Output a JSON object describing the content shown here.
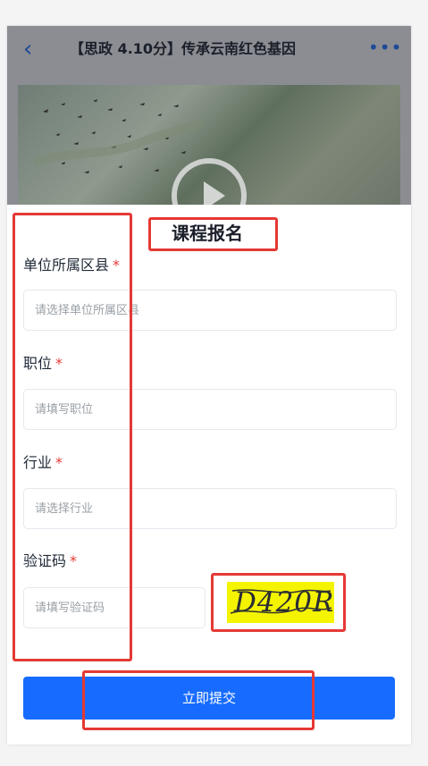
{
  "header": {
    "title": "【思政 4.10分】传承云南红色基因",
    "back_icon": "chevron-left-icon",
    "more_icon": "more-icon"
  },
  "video": {
    "play_icon": "play-icon"
  },
  "form": {
    "title": "课程报名",
    "fields": [
      {
        "label": "单位所属区县",
        "required": "*",
        "placeholder": "请选择单位所属区县"
      },
      {
        "label": "职位",
        "required": "*",
        "placeholder": "请填写职位"
      },
      {
        "label": "行业",
        "required": "*",
        "placeholder": "请选择行业"
      },
      {
        "label": "验证码",
        "required": "*",
        "placeholder": "请填写验证码"
      }
    ],
    "captcha_text": "D420R",
    "submit_label": "立即提交"
  },
  "annotation_color": "#e53935"
}
